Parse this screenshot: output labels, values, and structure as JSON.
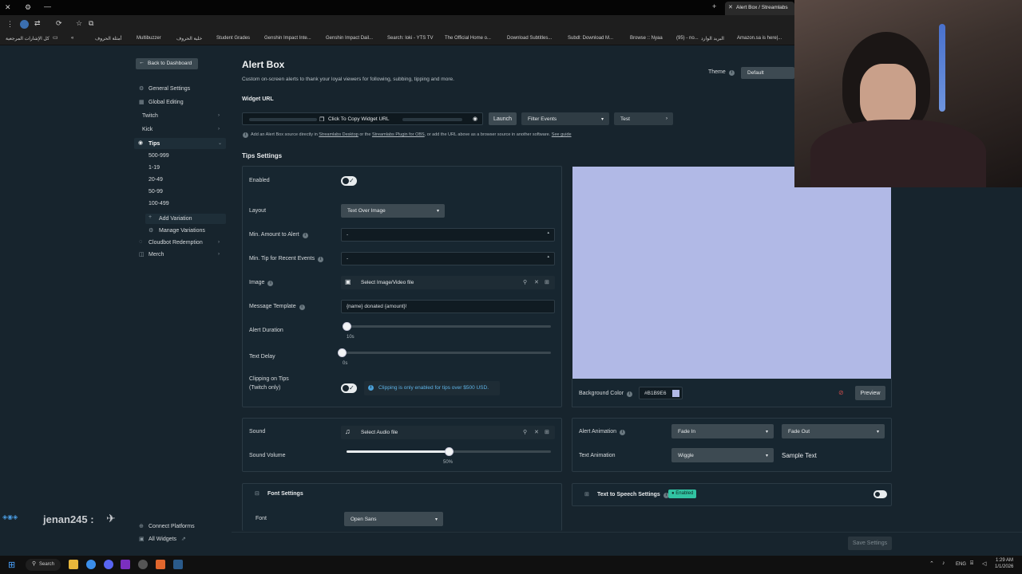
{
  "browser": {
    "tab_title": "Alert Box / Streamlabs",
    "bookmarks": [
      "كل الإشارات المرجعية",
      "أمثلة الحروف",
      "Multibuzzer",
      "خلية الحروف",
      "Student Grades",
      "Genshin Impact Inte...",
      "Genshin Impact Dail...",
      "Search: loki - YTS TV",
      "The Official Home o...",
      "Download Subtitles...",
      "Subdl: Download M...",
      "Browse :: Nyaa",
      "(95) - no...",
      "البريد الوارد",
      "Amazon.sa is here|..."
    ]
  },
  "sidebar": {
    "back_label": "Back to Dashboard",
    "general_settings": "General Settings",
    "global_editing": "Global Editing",
    "twitch": "Twitch",
    "kick": "Kick",
    "tips": "Tips",
    "variations": [
      "500-999",
      "1-19",
      "20-49",
      "50-99",
      "100-499"
    ],
    "add_variation": "Add Variation",
    "manage_variations": "Manage Variations",
    "cloudbot": "Cloudbot Redemption",
    "merch": "Merch",
    "connect_platforms": "Connect Platforms",
    "all_widgets": "All Widgets"
  },
  "header": {
    "title": "Alert Box",
    "subtitle": "Custom on-screen alerts to thank your loyal viewers for following, subbing, tipping and more.",
    "theme_label": "Theme",
    "theme_value": "Default"
  },
  "widget_url": {
    "label": "Widget URL",
    "copy_label": "Click To Copy Widget URL",
    "launch": "Launch",
    "filter_events": "Filter Events",
    "test": "Test",
    "hint_prefix": "Add an Alert Box source directly in",
    "link_desktop": "Streamlabs Desktop",
    "hint_mid": "or the",
    "link_plugin": "Streamlabs Plugin for OBS",
    "hint_suffix": ", or add the URL above as a browser source in another software.",
    "link_guide": "See guide"
  },
  "tips_settings": {
    "section_title": "Tips Settings",
    "enabled_label": "Enabled",
    "layout_label": "Layout",
    "layout_value": "Text Over Image",
    "min_amount_label": "Min. Amount to Alert",
    "min_amount_value": "-",
    "min_tip_label": "Min. Tip for Recent Events",
    "min_tip_value": "-",
    "image_label": "Image",
    "image_value": "Select Image/Video file",
    "message_label": "Message Template",
    "message_value": "{name} donated {amount}!",
    "duration_label": "Alert Duration",
    "duration_value": "10s",
    "duration_fraction": 0.0,
    "delay_label": "Text Delay",
    "delay_value": "0s",
    "delay_fraction": 0.0,
    "clipping_label_1": "Clipping on Tips",
    "clipping_label_2": "(Twitch only)",
    "clipping_notice": "Clipping is only enabled for tips over $500 USD."
  },
  "preview": {
    "color": "#B1B9E6",
    "bg_label": "Background Color",
    "bg_value": "#B1B9E6",
    "preview_button": "Preview"
  },
  "sound": {
    "sound_label": "Sound",
    "sound_value": "Select Audio file",
    "volume_label": "Sound Volume",
    "volume_value": "50%",
    "volume_fraction": 0.5
  },
  "animation": {
    "alert_label": "Alert Animation",
    "alert_in": "Fade In",
    "alert_out": "Fade Out",
    "text_label": "Text Animation",
    "text_value": "Wiggle",
    "sample": "Sample Text"
  },
  "font": {
    "section": "Font Settings",
    "font_label": "Font",
    "font_value": "Open Sans"
  },
  "tts": {
    "label": "Text to Speech Settings",
    "badge": "Enabled"
  },
  "footer": {
    "save": "Save Settings"
  },
  "overlay": {
    "username": "jenan245 :"
  },
  "taskbar": {
    "search": "Search",
    "lang": "ENG",
    "time": "1:29 AM",
    "date": "1/1/2026"
  }
}
